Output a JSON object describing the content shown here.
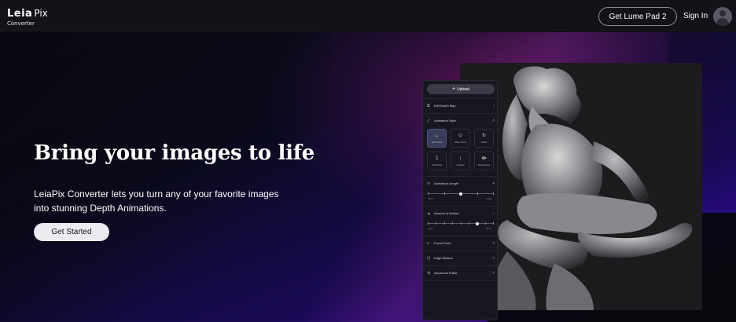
{
  "header": {
    "brand_main": "Leia",
    "brand_suffix": "Pix",
    "brand_sub": "Converter",
    "cta_label": "Get Lume Pad 2",
    "signin_label": "Sign In",
    "avatar_icon": "user-avatar-icon"
  },
  "hero": {
    "headline": "Bring your images to life",
    "description": "LeiaPix Converter lets you turn any of your favorite images into stunning Depth Animations.",
    "start_button": "Get Started"
  },
  "panel": {
    "upload_label": "Upload",
    "sections": {
      "edit_depth_map": "Edit Depth Map",
      "animation_style": "Animation Style",
      "animation_length": "Animation Length",
      "amount_of_motion": "Amount of Motion",
      "focus_point": "Focus Point",
      "edge_dilation": "Edge Dilation",
      "advanced_editor": "Advanced Editor"
    },
    "styles": [
      {
        "label": "Horizontal",
        "icon": "horizontal-arrows-icon",
        "active": true
      },
      {
        "label": "Wide Circle",
        "icon": "wide-circle-icon",
        "active": false
      },
      {
        "label": "Circle",
        "icon": "circle-icon",
        "active": false
      },
      {
        "label": "Tall Circle",
        "icon": "tall-circle-icon",
        "active": false
      },
      {
        "label": "Vertical",
        "icon": "vertical-arrows-icon",
        "active": false
      },
      {
        "label": "Perspective",
        "icon": "perspective-icon",
        "active": false
      }
    ],
    "length_labels": {
      "min": "Short",
      "max": "Long"
    },
    "motion_labels": {
      "min": "Less",
      "max": "More"
    },
    "length_value": 0.5,
    "motion_value": 0.75
  }
}
